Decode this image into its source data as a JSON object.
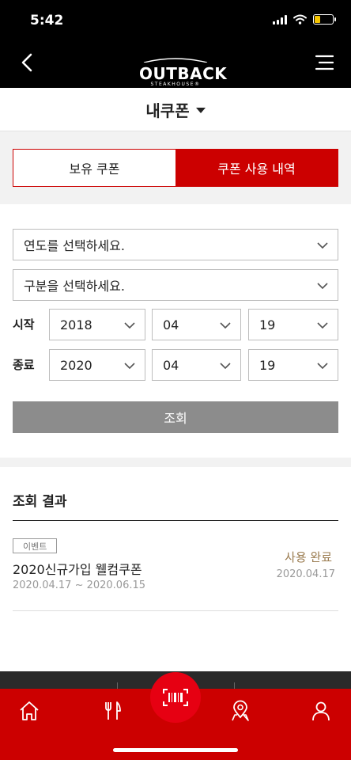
{
  "status": {
    "time": "5:42"
  },
  "header": {
    "logo_main": "OUTBACK",
    "logo_sub": "STEAKHOUSE®"
  },
  "title": "내쿠폰",
  "tabs": {
    "owned": "보유 쿠폰",
    "history": "쿠폰 사용 내역"
  },
  "filters": {
    "year_placeholder": "연도를 선택하세요.",
    "category_placeholder": "구분을 선택하세요.",
    "start_label": "시작",
    "end_label": "종료",
    "start": {
      "year": "2018",
      "month": "04",
      "day": "19"
    },
    "end": {
      "year": "2020",
      "month": "04",
      "day": "19"
    },
    "search_label": "조회"
  },
  "results": {
    "title": "조회 결과",
    "items": [
      {
        "badge": "이벤트",
        "name": "2020신규가입 웰컴쿠폰",
        "period": "2020.04.17 ~ 2020.06.15",
        "status": "사용 완료",
        "used_date": "2020.04.17"
      }
    ]
  },
  "icons": {
    "back": "chevron-left-icon",
    "menu": "hamburger-icon",
    "home": "home-icon",
    "menu_food": "fork-knife-icon",
    "scan": "barcode-scan-icon",
    "location": "map-pin-icon",
    "profile": "user-icon"
  },
  "colors": {
    "brand_red": "#cc0000",
    "status_brown": "#9a7b4f",
    "disabled_gray": "#8c8c8c"
  }
}
